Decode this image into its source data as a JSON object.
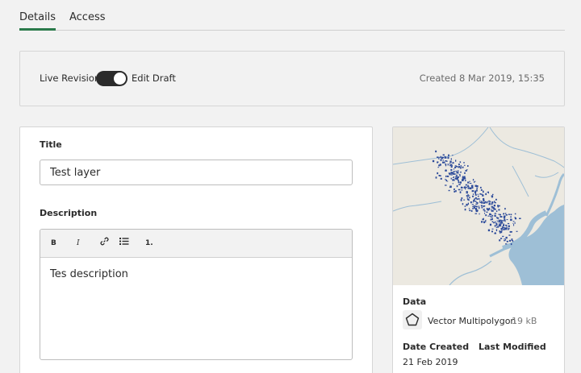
{
  "tabs": [
    {
      "label": "Details",
      "active": true
    },
    {
      "label": "Access",
      "active": false
    }
  ],
  "revision": {
    "left_label": "Live Revision",
    "right_label": "Edit Draft",
    "toggle_on": true,
    "created": "Created 8 Mar 2019, 15:35"
  },
  "form": {
    "title_label": "Title",
    "title_value": "Test layer",
    "description_label": "Description",
    "toolbar": {
      "bold": "B",
      "italic": "I",
      "link_icon": "link-icon",
      "bullet_icon": "bullet-list-icon",
      "numbered": "1."
    },
    "description_value": "Tes description"
  },
  "info": {
    "data_label": "Data",
    "type_icon": "polygon-icon",
    "type": "Vector Multipolygon",
    "size": "19 kB",
    "date_created_label": "Date Created",
    "last_modified_label": "Last Modified",
    "date_created": "21 Feb 2019"
  },
  "colors": {
    "accent": "#2a7a4a",
    "map_land": "#ece9e1",
    "map_water": "#9ebfd6",
    "map_points": "#2d4b9a"
  }
}
